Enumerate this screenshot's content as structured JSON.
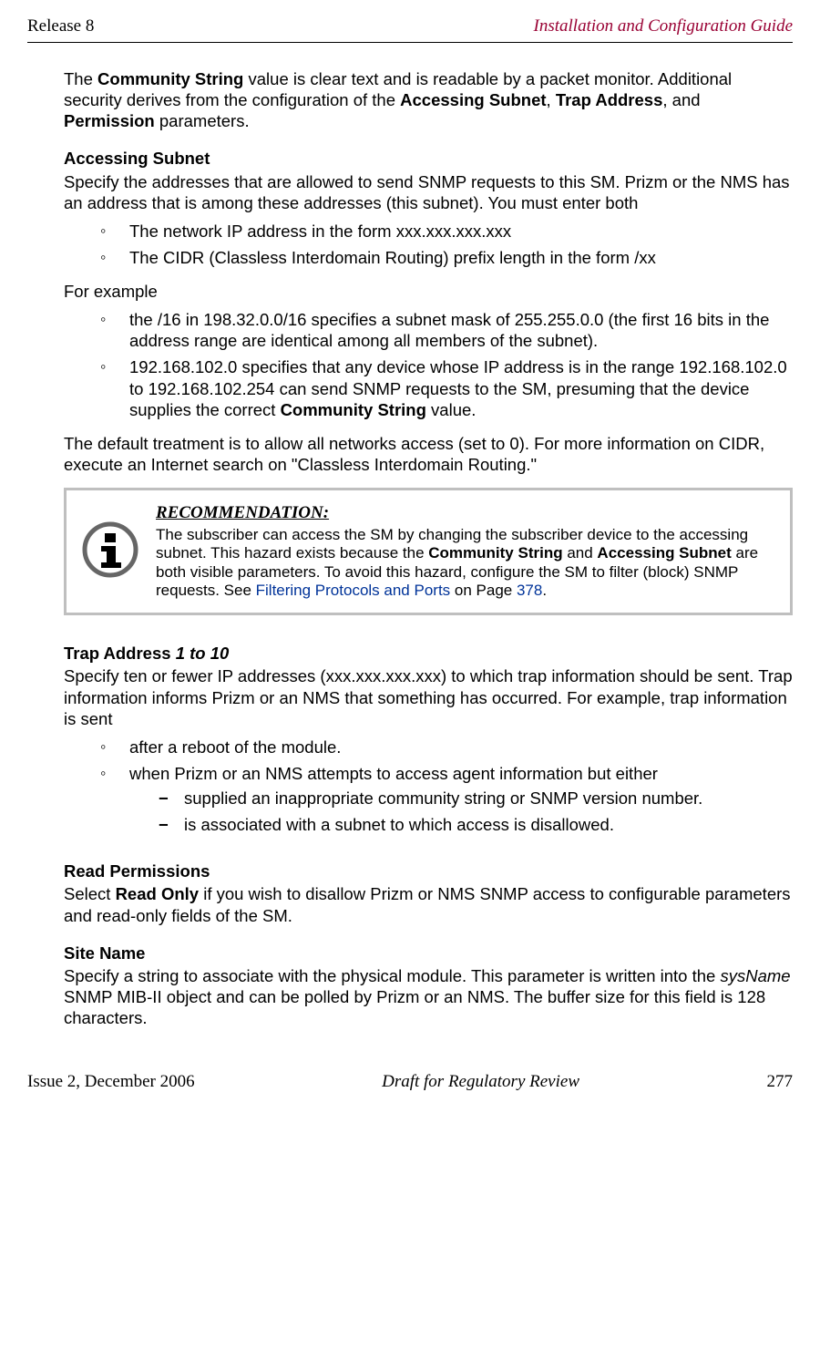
{
  "header": {
    "release": "Release 8",
    "guide": "Installation and Configuration Guide"
  },
  "intro": {
    "p1a": "The ",
    "p1b_bold": "Community String",
    "p1c": " value is clear text and is readable by a packet monitor. Additional security derives from the configuration of the ",
    "p1d_bold": "Accessing Subnet",
    "p1e": ", ",
    "p1f_bold": "Trap Address",
    "p1g": ", and ",
    "p1h_bold": "Permission",
    "p1i": " parameters."
  },
  "accessing": {
    "heading": "Accessing Subnet",
    "p1": "Specify the addresses that are allowed to send SNMP requests to this SM. Prizm or the NMS has an address that is among these addresses (this subnet). You must enter both",
    "list1": {
      "i1": "The network IP address in the form xxx.xxx.xxx.xxx",
      "i2": "The CIDR (Classless Interdomain Routing) prefix length in the form /xx"
    },
    "p2": "For example",
    "list2": {
      "i1": "the /16 in 198.32.0.0/16 specifies a subnet mask of 255.255.0.0 (the first 16 bits in the address range are identical among all members of the subnet).",
      "i2a": "192.168.102.0 specifies that any device whose IP address is in the range 192.168.102.0 to 192.168.102.254 can send SNMP requests to the SM, presuming that the device supplies the correct ",
      "i2b_bold": "Community String",
      "i2c": " value."
    },
    "p3": "The default treatment is to allow all networks access (set to 0). For more information on CIDR, execute an Internet search on \"Classless Interdomain Routing.\""
  },
  "callout": {
    "title": "RECOMMENDATION:",
    "t1": "The subscriber can access the SM by changing the subscriber device to the accessing subnet. This hazard exists because the ",
    "t2_bold": "Community String",
    "t3": " and ",
    "t4_bold": "Accessing Subnet",
    "t5": " are both visible parameters. To avoid this hazard, configure the SM to filter (block) SNMP requests. See ",
    "t6_link": "Filtering Protocols and Ports",
    "t7": " on Page ",
    "t8_link": "378",
    "t9": "."
  },
  "trap": {
    "heading_a": "Trap Address ",
    "heading_b_italic": "1 to 10",
    "p1": "Specify ten or fewer IP addresses (xxx.xxx.xxx.xxx) to which trap information should be sent. Trap information informs Prizm or an NMS that something has occurred. For example, trap information is sent",
    "list": {
      "i1": "after a reboot of the module.",
      "i2": "when Prizm or an NMS attempts to access agent information but either",
      "sub": {
        "s1": "supplied an inappropriate community string or SNMP version number.",
        "s2": "is associated with a subnet to which access is disallowed."
      }
    }
  },
  "read": {
    "heading": "Read Permissions",
    "p1a": "Select ",
    "p1b_bold": "Read Only",
    "p1c": " if you wish to disallow Prizm or NMS SNMP access to configurable parameters and read-only fields of the SM."
  },
  "site": {
    "heading": "Site Name",
    "p1a": "Specify a string to associate with the physical module. This parameter is written into the ",
    "p1b_italic": "sysName",
    "p1c": " SNMP MIB-II object and can be polled by Prizm or an NMS. The buffer size for this field is 128 characters."
  },
  "footer": {
    "left": "Issue 2, December 2006",
    "center": "Draft for Regulatory Review",
    "right": "277"
  }
}
